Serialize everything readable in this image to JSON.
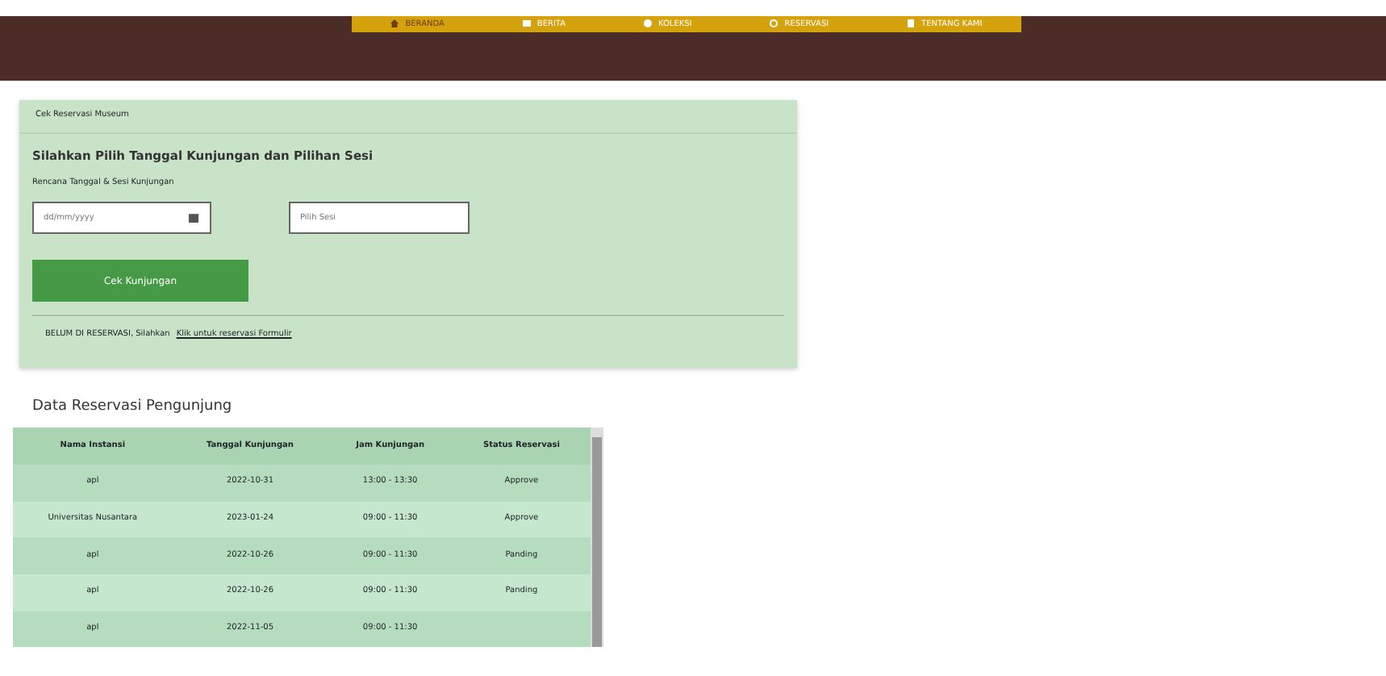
{
  "nav": [
    {
      "label": "BERANDA",
      "kind": "home",
      "selected": true
    },
    {
      "label": "BERITA",
      "kind": "news",
      "selected": false
    },
    {
      "label": "KOLEKSI",
      "kind": "star",
      "selected": false
    },
    {
      "label": "RESERVASI",
      "kind": "clock",
      "selected": false
    },
    {
      "label": "TENTANG KAMI",
      "kind": "book",
      "selected": false
    }
  ],
  "card": {
    "header": "Cek Reservasi Museum",
    "title": "Silahkan Pilih Tanggal Kunjungan dan Pilihan Sesi",
    "label": "Rencana Tanggal & Sesi Kunjungan",
    "date_field": {
      "placeholder": "dd/mm/yyyy"
    },
    "session_field": {
      "placeholder": "Pilih Sesi"
    },
    "button": "Cek Kunjungan",
    "footer_text": "BELUM DI RESERVASI, Silahkan",
    "footer_link": "Klik untuk reservasi Formulir"
  },
  "table": {
    "title": "Data Reservasi Pengunjung",
    "columns": [
      "Nama Instansi",
      "Tanggal Kunjungan",
      "Jam Kunjungan",
      "Status Reservasi"
    ],
    "rows": [
      [
        "apl",
        "2022-10-31",
        "13:00 - 13:30",
        "Approve"
      ],
      [
        "Universitas Nusantara",
        "2023-01-24",
        "09:00 - 11:30",
        "Approve"
      ],
      [
        "apl",
        "2022-10-26",
        "09:00 - 11:30",
        "Panding"
      ],
      [
        "apl",
        "2022-10-26",
        "09:00 - 11:30",
        "Panding"
      ],
      [
        "apl",
        "2022-11-05",
        "09:00 - 11:30",
        ""
      ]
    ]
  }
}
